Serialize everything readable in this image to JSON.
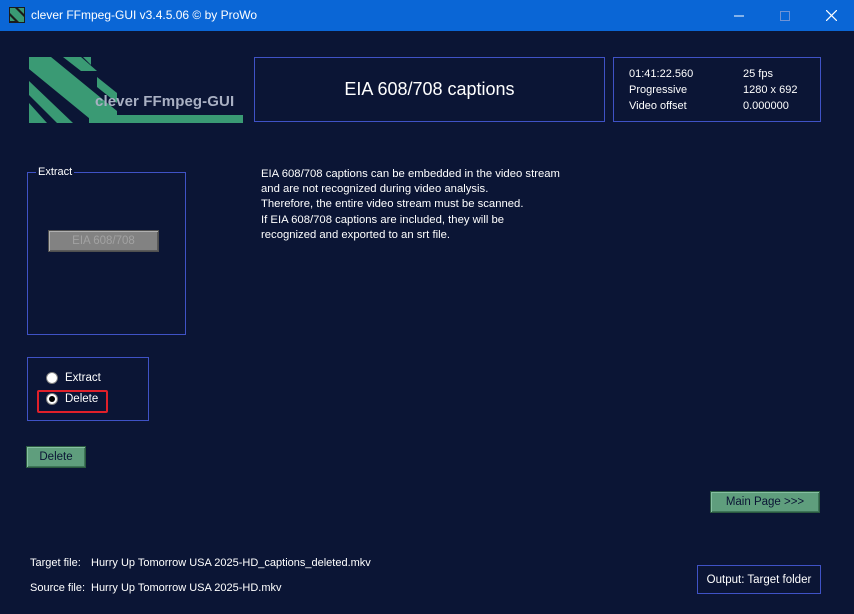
{
  "window": {
    "title": "clever FFmpeg-GUI v3.4.5.06   © by ProWo",
    "colors": {
      "titlebar": "#0a66d6",
      "background": "#0b1535",
      "frame": "#3f52c6",
      "accent_green": "#5f9e7d",
      "logo_green": "#3a9a74",
      "highlight": "#e0202a"
    }
  },
  "logo": {
    "text": "clever FFmpeg-GUI",
    "icon": "ffmpeg-logo-icon"
  },
  "header": {
    "title": "EIA 608/708 captions"
  },
  "info": {
    "duration": "01:41:22.560",
    "fps": "25 fps",
    "scan": "Progressive",
    "resolution": "1280 x 692",
    "offset_label": "Video offset",
    "offset_value": "0.000000"
  },
  "extract_group": {
    "label": "Extract",
    "button": "EIA 608/708"
  },
  "description": [
    "EIA 608/708 captions can be embedded in the video stream",
    "and are not recognized during video analysis.",
    "Therefore, the entire video stream must be scanned.",
    "If EIA 608/708 captions are included, they will be",
    "recognized and exported to an srt file."
  ],
  "mode": {
    "options": [
      {
        "label": "Extract",
        "checked": false
      },
      {
        "label": "Delete",
        "checked": true
      }
    ]
  },
  "action_button": "Delete",
  "main_page_button": "Main Page >>>",
  "footer": {
    "target_label": "Target file:",
    "target_value": "Hurry Up Tomorrow USA 2025-HD_captions_deleted.mkv",
    "source_label": "Source file:",
    "source_value": "Hurry Up Tomorrow USA 2025-HD.mkv",
    "output_button": "Output: Target folder"
  }
}
